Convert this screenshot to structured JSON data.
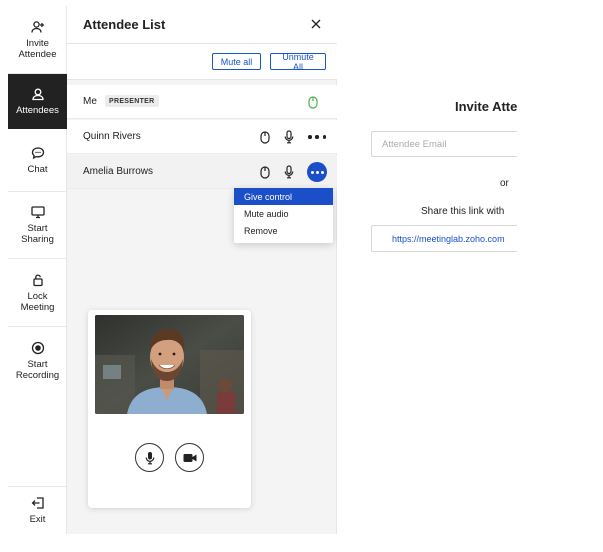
{
  "sidebar": {
    "items": [
      {
        "label": "Invite Attendee",
        "icon": "add-person-icon"
      },
      {
        "label": "Attendees",
        "icon": "people-icon",
        "active": true
      },
      {
        "label": "Chat",
        "icon": "chat-bubble-icon"
      },
      {
        "label": "Start Sharing",
        "icon": "screen-share-icon"
      },
      {
        "label": "Lock Meeting",
        "icon": "lock-icon"
      },
      {
        "label": "Start Recording",
        "icon": "record-icon"
      }
    ],
    "exit_label": "Exit"
  },
  "panel": {
    "title": "Attendee List",
    "mute_all_label": "Mute all",
    "unmute_all_label": "Unmute All",
    "attendees": [
      {
        "name": "Me",
        "badge": "PRESENTER",
        "mic_color": "#4caf50"
      },
      {
        "name": "Quinn Rivers"
      },
      {
        "name": "Amelia Burrows"
      }
    ],
    "menu": {
      "items": [
        "Give control",
        "Mute audio",
        "Remove"
      ],
      "selected": "Give control"
    }
  },
  "invite": {
    "title": "Invite Atte",
    "email_placeholder": "Attendee Email",
    "or_label": "or",
    "share_text": "Share this link with ",
    "link": "https://meetinglab.zoho.com"
  },
  "colors": {
    "accent": "#1a4fc9",
    "active_rail": "#222222",
    "mic_active": "#4caf50"
  }
}
